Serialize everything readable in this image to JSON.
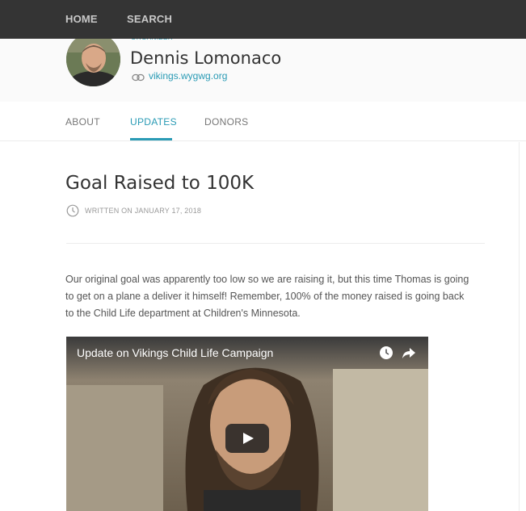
{
  "topnav": {
    "home": "HOME",
    "search": "SEARCH"
  },
  "profile": {
    "organizer_label": "ORGANIZER",
    "name": "Dennis Lomonaco",
    "site": "vikings.wygwg.org"
  },
  "tabs": [
    {
      "label": "ABOUT"
    },
    {
      "label": "UPDATES",
      "active": true
    },
    {
      "label": "DONORS"
    }
  ],
  "post": {
    "title": "Goal Raised to 100K",
    "written": "WRITTEN ON JANUARY 17, 2018",
    "body": "Our original goal was apparently too low so we are raising it, but this time Thomas is going to get on a plane a deliver it himself! Remember, 100% of the money raised is going back to the Child Life department at Children's Minnesota."
  },
  "video": {
    "title": "Update on Vikings Child Life Campaign",
    "icons": [
      "clock-icon",
      "share-icon",
      "play-icon"
    ]
  },
  "colors": {
    "accent": "#2a9bb5",
    "navbar": "#343434"
  }
}
